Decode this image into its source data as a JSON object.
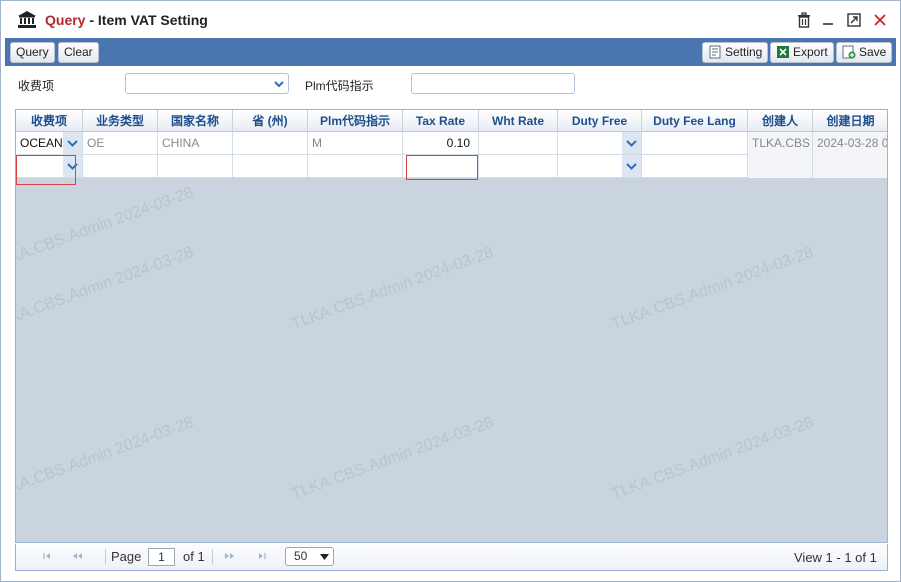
{
  "window": {
    "title_prefix": "Query",
    "title_separator": " - ",
    "title": "Item VAT Setting"
  },
  "toolbar": {
    "query_label": "Query",
    "clear_label": "Clear",
    "setting_label": "Setting",
    "export_label": "Export",
    "save_label": "Save"
  },
  "filters": {
    "charge_item_label": "收费项",
    "charge_item_value": "",
    "plm_label": "Plm代码指示",
    "plm_value": ""
  },
  "grid": {
    "columns": [
      "收费项",
      "业务类型",
      "国家名称",
      "省 (州)",
      "Plm代码指示",
      "Tax Rate",
      "Wht Rate",
      "Duty Free",
      "Duty Fee Lang",
      "创建人",
      "创建日期"
    ],
    "rows": [
      {
        "charge_item": "OCEAN",
        "business_type": "OE",
        "country": "CHINA",
        "province": "",
        "plm": "M",
        "tax_rate": "0.10",
        "wht_rate": "",
        "duty_free": "",
        "duty_fee_lang": "",
        "creator": "TLKA.CBS",
        "created_date": "2024-03-28 0"
      },
      {
        "charge_item": "",
        "business_type": "",
        "country": "",
        "province": "",
        "plm": "",
        "tax_rate": "",
        "wht_rate": "",
        "duty_free": "",
        "duty_fee_lang": "",
        "creator": "",
        "created_date": ""
      }
    ]
  },
  "watermark": "TLKA.CBS.Admin 2024-03-28",
  "pager": {
    "page_label": "Page",
    "page_value": "1",
    "of_label": "of 1",
    "page_size": "50",
    "view_text": "View 1 - 1 of 1"
  },
  "colors": {
    "toolbar_bg": "#4a75b0",
    "title_accent": "#b02a2a",
    "header_text": "#1f4e8c",
    "grid_bg": "#c9d4de",
    "error_border": "#e04040"
  },
  "icons": [
    "bank-icon",
    "trash-icon",
    "minimize-icon",
    "maximize-icon",
    "close-icon",
    "setting-icon",
    "excel-icon",
    "save-icon",
    "chevron-down-icon",
    "first-page-icon",
    "prev-page-icon",
    "next-page-icon",
    "last-page-icon"
  ]
}
